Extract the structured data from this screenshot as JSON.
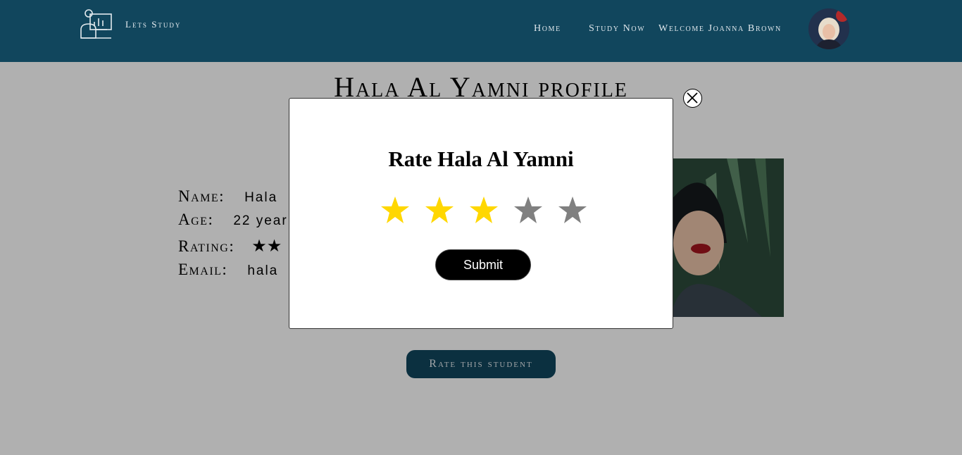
{
  "header": {
    "logo_text": "Lets Study",
    "nav": {
      "home": "Home",
      "study_now": "Study Now",
      "welcome": "Welcome Joanna Brown"
    }
  },
  "profile": {
    "title": "Hala Al Yamni profile",
    "labels": {
      "name": "Name:",
      "age": "Age:",
      "rating": "Rating:",
      "email": "Email:"
    },
    "values": {
      "name": "Hala",
      "age": "22 year",
      "rating_stars": "★★",
      "email": "hala"
    },
    "rate_button": "Rate this student"
  },
  "modal": {
    "title": "Rate Hala Al Yamni",
    "rating": {
      "selected": 3,
      "max": 5
    },
    "submit_label": "Submit",
    "colors": {
      "star_active": "#ffd700",
      "star_inactive": "#808080"
    }
  },
  "colors": {
    "header_bg": "#11465d",
    "button_bg": "#11465d"
  }
}
